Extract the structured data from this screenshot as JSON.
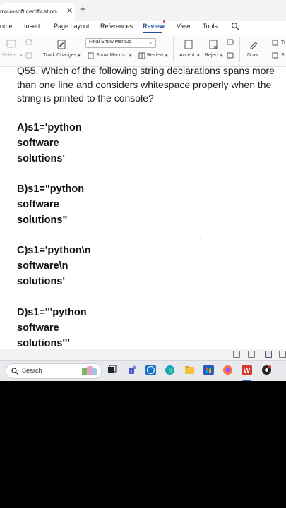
{
  "browser": {
    "tab_title": "microsoft certification",
    "tab_close": "✕",
    "new_tab": "+"
  },
  "menu": {
    "items": [
      "ome",
      "Insert",
      "Page Layout",
      "References",
      "Review",
      "View",
      "Tools"
    ],
    "active": "Review"
  },
  "ribbon": {
    "delete_label": "Delete",
    "track_changes": "Track Changes",
    "markup_dropdown": "Final Show Markup",
    "show_markup": "Show Markup",
    "review": "Review",
    "accept": "Accept",
    "reject": "Reject",
    "draw": "Draw",
    "tr_partial": "Tr",
    "sl_partial": "Sl"
  },
  "document": {
    "question": "Q55. Which of the following string declarations spans more than one line and considers whitespace properly when the string is printed to the console?",
    "options": [
      "A)s1='python\nsoftware\nsolutions'",
      "B)s1=\"python\nsoftware\nsolutions\"",
      "C)s1='python\\n\nsoftware\\n\nsolutions'",
      "D)s1='''python\nsoftware\nsolutions'''"
    ]
  },
  "taskbar": {
    "search_label": "Search"
  },
  "colors": {
    "accent": "#1f4fa0",
    "taskbar": "#e9eaee"
  }
}
